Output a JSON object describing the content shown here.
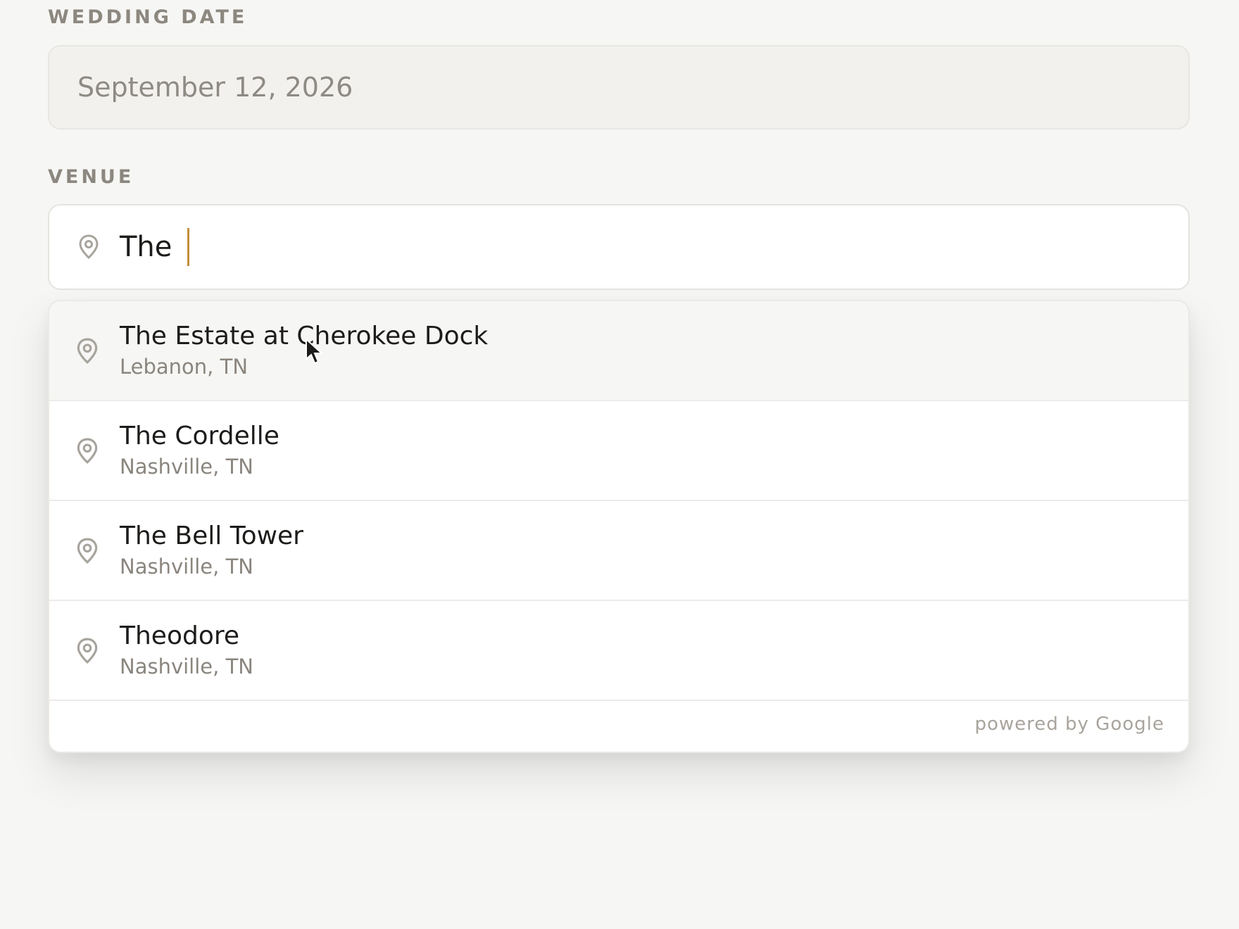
{
  "wedding_date": {
    "label": "WEDDING DATE",
    "value": "September 12, 2026"
  },
  "venue": {
    "label": "VENUE",
    "input_value": "The",
    "icon": "map-pin-icon",
    "caret_color": "#c28f3a"
  },
  "suggestions": [
    {
      "name": "The Estate at Cherokee Dock",
      "city": "Lebanon, TN",
      "highlighted": true
    },
    {
      "name": "The Cordelle",
      "city": "Nashville, TN",
      "highlighted": false
    },
    {
      "name": "The Bell Tower",
      "city": "Nashville, TN",
      "highlighted": false
    },
    {
      "name": "Theodore",
      "city": "Nashville, TN",
      "highlighted": false
    }
  ],
  "footer": {
    "powered_by": "powered by Google"
  }
}
